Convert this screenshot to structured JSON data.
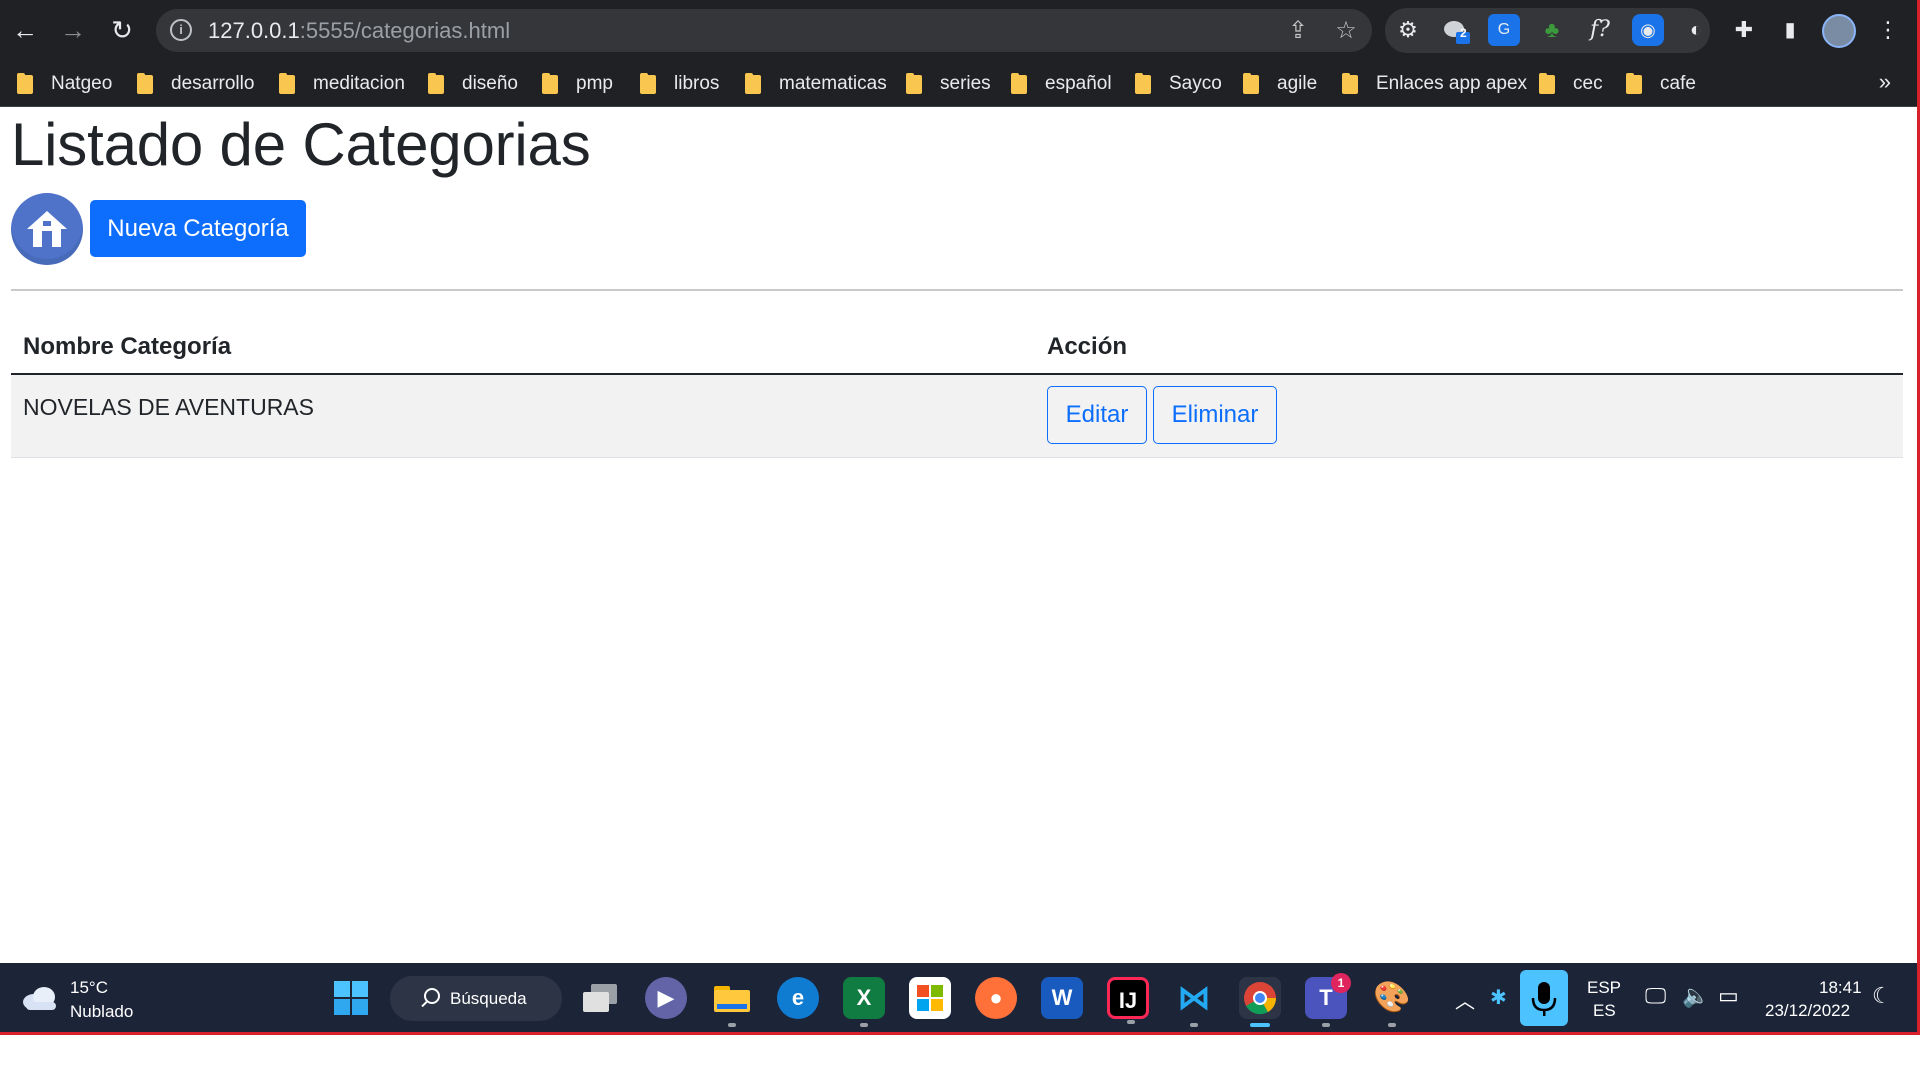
{
  "browser": {
    "url_host": "127.0.0.1",
    "url_rest": ":5555/categorias.html",
    "extension_badge": "2",
    "bookmarks": [
      "Natgeo",
      "desarrollo",
      "meditacion",
      "diseño",
      "pmp",
      "libros",
      "matematicas",
      "series",
      "español",
      "Sayco",
      "agile",
      "Enlaces app apex",
      "cec",
      "cafe"
    ],
    "bookmarks_overflow": "»"
  },
  "page": {
    "title": "Listado de Categorias",
    "new_button": "Nueva Categoría",
    "table": {
      "headers": [
        "Nombre Categoría",
        "Acción"
      ],
      "rows": [
        {
          "name": "NOVELAS DE AVENTURAS",
          "edit_label": "Editar",
          "delete_label": "Eliminar"
        }
      ]
    }
  },
  "taskbar": {
    "weather_temp": "15°C",
    "weather_desc": "Nublado",
    "search_label": "Búsqueda",
    "teams_badge": "1",
    "lang_top": "ESP",
    "lang_bottom": "ES",
    "time": "18:41",
    "date": "23/12/2022"
  },
  "colors": {
    "primary": "#0d6efd",
    "browser_frame": "#202124",
    "taskbar": "#1c2538",
    "screen_border": "#d8202a"
  }
}
